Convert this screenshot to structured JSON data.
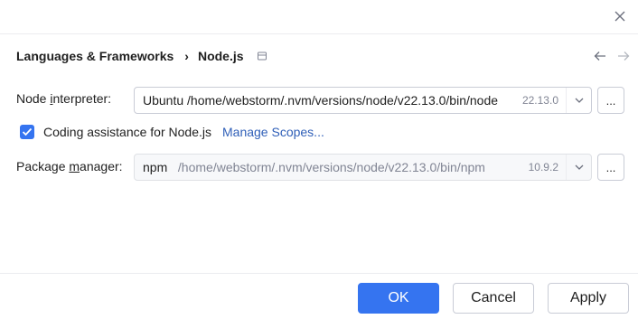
{
  "header": {
    "breadcrumb_parent": "Languages & Frameworks",
    "breadcrumb_separator": "›",
    "breadcrumb_current": "Node.js"
  },
  "interpreter": {
    "label_prefix": "Node ",
    "label_mnemonic": "i",
    "label_suffix": "nterpreter:",
    "value_prefix": "Ubuntu",
    "value_path": "/home/webstorm/.nvm/versions/node/v22.13.0/bin/node",
    "version": "22.13.0",
    "browse_label": "..."
  },
  "coding_assistance": {
    "checked": true,
    "label": "Coding assistance for Node.js",
    "manage_scopes_link": "Manage Scopes..."
  },
  "package_manager": {
    "label_prefix": "Package ",
    "label_mnemonic": "m",
    "label_suffix": "anager:",
    "value_name": "npm",
    "value_path": "/home/webstorm/.nvm/versions/node/v22.13.0/bin/npm",
    "version": "10.9.2",
    "browse_label": "..."
  },
  "footer": {
    "ok_label": "OK",
    "cancel_label": "Cancel",
    "apply_label": "Apply"
  },
  "colors": {
    "accent": "#3574f0",
    "link": "#2f5fb8",
    "muted_text": "#818594"
  },
  "icons": {
    "close": "close-icon",
    "back": "arrow-left-icon",
    "forward": "arrow-right-icon",
    "scope": "project-scope-icon",
    "dropdown": "chevron-down-icon",
    "check": "checkmark-icon"
  }
}
